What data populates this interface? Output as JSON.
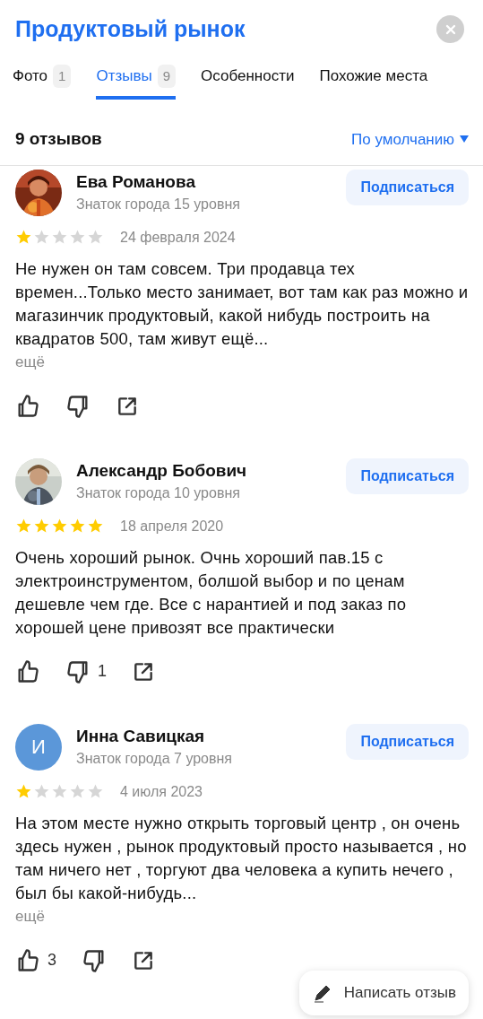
{
  "title": "Продуктовый рынок",
  "tabs": [
    {
      "label": "Фото",
      "count": "1",
      "selected": false
    },
    {
      "label": "Отзывы",
      "count": "9",
      "selected": true
    },
    {
      "label": "Особенности",
      "selected": false
    },
    {
      "label": "Похожие места",
      "selected": false
    }
  ],
  "reviews_count": "9 отзывов",
  "sort": "По умолчанию",
  "reviews": [
    {
      "name": "Ева Романова",
      "level": "Знаток города 15 уровня",
      "subscribe": "Подписаться",
      "stars": 1,
      "date": "24 февраля 2024",
      "text": "Не нужен он там совсем. Три продавца тех времен...Только место занимает, вот там как раз можно и магазинчик продуктовый, какой нибудь построить на квадратов 500, там живут ещё...",
      "more": "ещё"
    },
    {
      "name": "Александр Бобович",
      "level": "Знаток города 10 уровня",
      "subscribe": "Подписаться",
      "stars": 5,
      "date": "18 апреля 2020",
      "text": "Очень хороший рынок. Очнь хороший пав.15 с электроинструментом, болшой выбор и по ценам дешевле чем где. Все с нарантией и под заказ по хорошей цене привозят все практически",
      "dislikes": "1"
    },
    {
      "avatar": {
        "kind": "letter",
        "letter": "И",
        "color": "#5b97d9"
      },
      "name": "Инна Савицкая",
      "level": "Знаток города 7 уровня",
      "subscribe": "Подписаться",
      "stars": 1,
      "date": "4 июля 2023",
      "text": "На этом месте нужно открыть торговый центр , он очень здесь нужен , рынок продуктовый просто называется , но там ничего нет , торгуют два человека а купить нечего , был бы какой-нибудь...",
      "more": "ещё",
      "likes": "3"
    }
  ],
  "write_review": "Написать отзыв"
}
